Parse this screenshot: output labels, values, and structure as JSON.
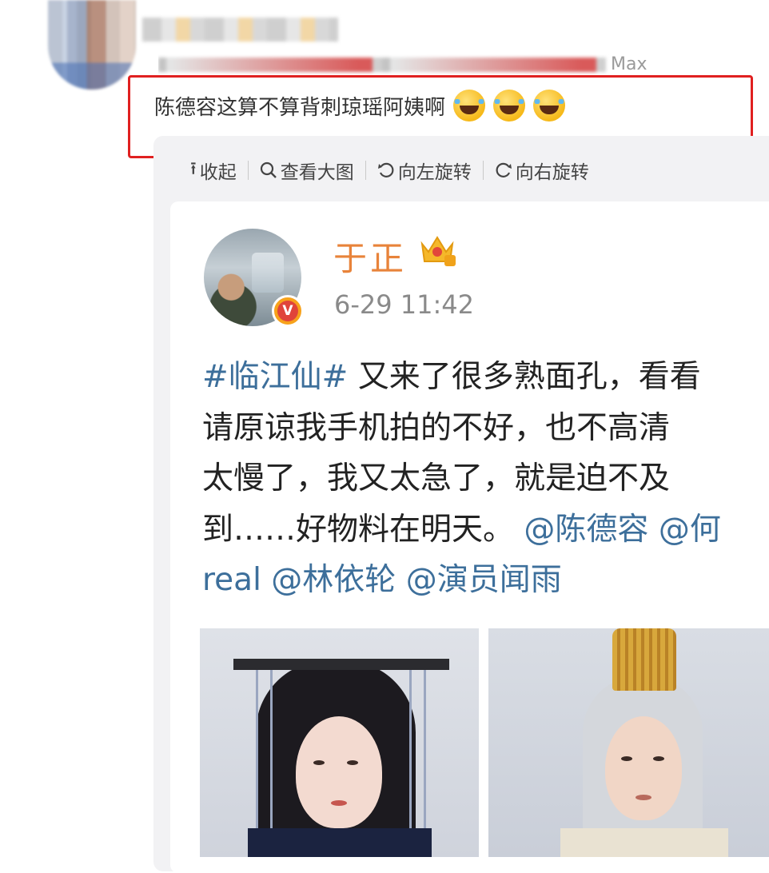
{
  "comment": {
    "meta_suffix": "Max",
    "text": "陈德容这算不算背刺琼瑶阿姨啊",
    "emoji_icons": [
      "laugh-cry-icon",
      "laugh-cry-icon",
      "laugh-cry-icon"
    ]
  },
  "toolbar": {
    "collapse": "收起",
    "view_large": "查看大图",
    "rotate_left": "向左旋转",
    "rotate_right": "向右旋转"
  },
  "post": {
    "author": "于正",
    "verified_mark": "V",
    "time": "6-29 11:42",
    "tag": "#临江仙#",
    "line1_rest": " 又来了很多熟面孔，看看",
    "line2": "请原谅我手机拍的不好，也不高清",
    "line3": "太慢了，我又太急了，就是迫不及",
    "line4_text": "到……好物料在明天。",
    "line4_mention1": " @陈德容",
    "line4_mention2": " @何",
    "line5_real": "real",
    "line5_mention1": " @林依轮",
    "line5_mention2": " @演员闻雨"
  },
  "colors": {
    "highlight_border": "#e02020",
    "author": "#e8833a",
    "link": "#3d6f9b"
  }
}
